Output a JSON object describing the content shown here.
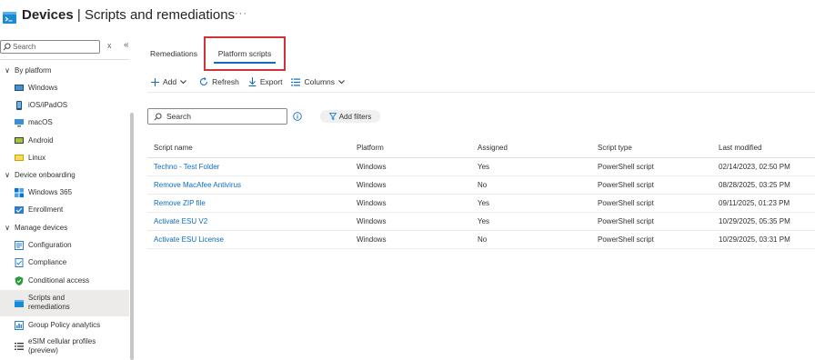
{
  "header": {
    "title_bold": "Devices",
    "title_rest": " | Scripts and remediations",
    "more": "···"
  },
  "sidebar": {
    "search_placeholder": "Search",
    "clear": "x",
    "collapse": "«",
    "groups": [
      {
        "label": "By platform",
        "chevron": "∨"
      },
      {
        "label": "Device onboarding",
        "chevron": "∨"
      },
      {
        "label": "Manage devices",
        "chevron": "∨"
      }
    ],
    "items": [
      {
        "label": "Windows",
        "icon": "windows-device-icon"
      },
      {
        "label": "iOS/iPadOS",
        "icon": "ios-device-icon"
      },
      {
        "label": "macOS",
        "icon": "macos-device-icon"
      },
      {
        "label": "Android",
        "icon": "android-device-icon"
      },
      {
        "label": "Linux",
        "icon": "linux-device-icon"
      },
      {
        "label": "Windows 365",
        "icon": "windows-365-icon"
      },
      {
        "label": "Enrollment",
        "icon": "enrollment-icon"
      },
      {
        "label": "Configuration",
        "icon": "configuration-icon"
      },
      {
        "label": "Compliance",
        "icon": "compliance-icon"
      },
      {
        "label": "Conditional access",
        "icon": "conditional-access-icon"
      },
      {
        "label_line1": "Scripts and",
        "label_line2": "remediations",
        "icon": "scripts-icon"
      },
      {
        "label": "Group Policy analytics",
        "icon": "group-policy-icon"
      },
      {
        "label_line1": "eSIM cellular profiles",
        "label_line2": "(preview)",
        "icon": "esim-icon"
      }
    ]
  },
  "tabs": [
    {
      "label": "Remediations",
      "selected": false
    },
    {
      "label": "Platform scripts",
      "selected": true
    }
  ],
  "toolbar": {
    "add": "Add",
    "refresh": "Refresh",
    "export": "Export",
    "columns": "Columns"
  },
  "grid": {
    "search_placeholder": "Search",
    "add_filters": "Add filters",
    "columns": [
      "Script name",
      "Platform",
      "Assigned",
      "Script type",
      "Last modified"
    ],
    "rows": [
      {
        "name": "Techno - Test Folder",
        "platform": "Windows",
        "assigned": "Yes",
        "type": "PowerShell script",
        "modified": "02/14/2023, 02:50 PM"
      },
      {
        "name": "Remove MacAfee Antivirus",
        "platform": "Windows",
        "assigned": "No",
        "type": "PowerShell script",
        "modified": "08/28/2025, 03:25 PM"
      },
      {
        "name": "Remove ZIP file",
        "platform": "Windows",
        "assigned": "Yes",
        "type": "PowerShell script",
        "modified": "09/11/2025, 01:23 PM"
      },
      {
        "name": "Activate ESU V2",
        "platform": "Windows",
        "assigned": "Yes",
        "type": "PowerShell script",
        "modified": "10/29/2025, 05:35 PM"
      },
      {
        "name": "Activate ESU License",
        "platform": "Windows",
        "assigned": "No",
        "type": "PowerShell script",
        "modified": "10/29/2025, 03:31 PM"
      }
    ]
  },
  "colors": {
    "accent": "#0f6cbd",
    "highlight_border": "#d13438",
    "selected_bg": "#edebe9"
  }
}
